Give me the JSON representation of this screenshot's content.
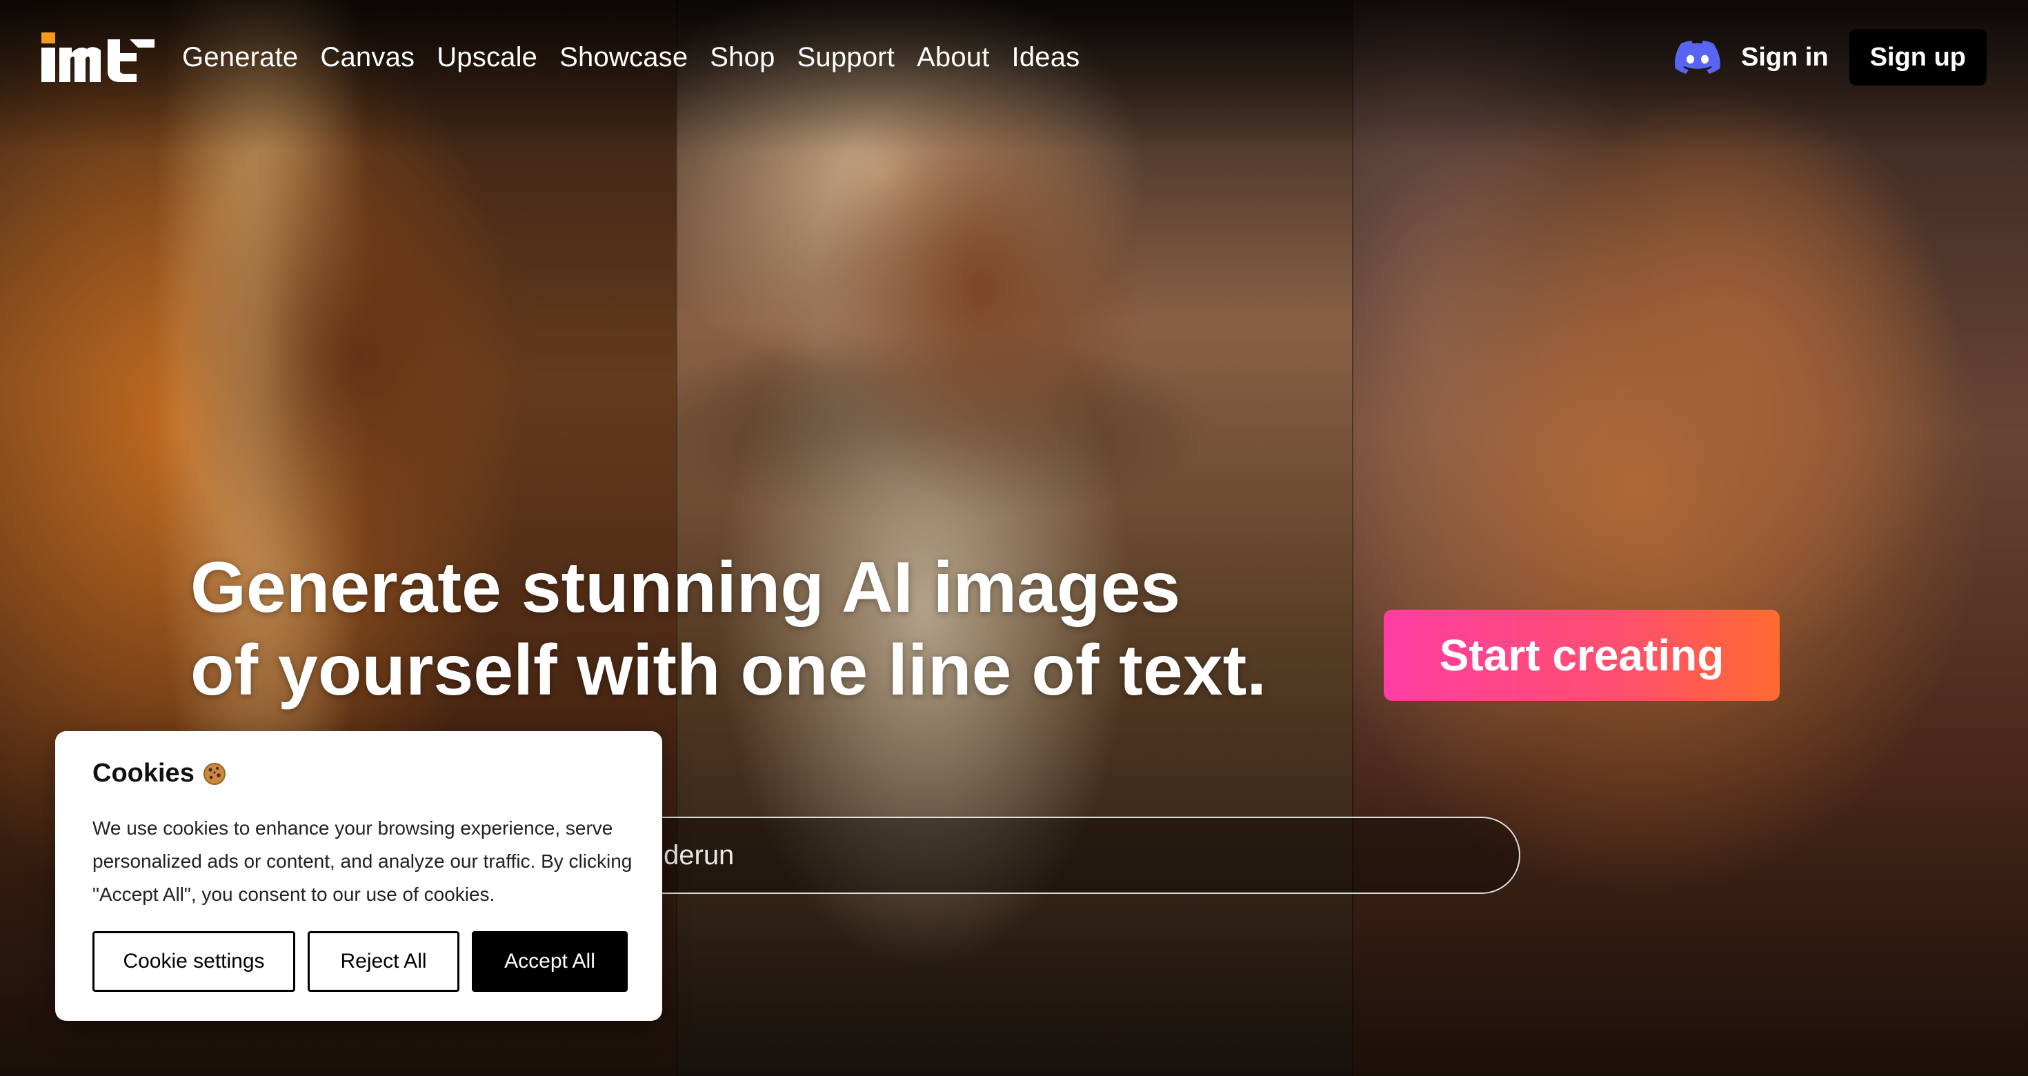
{
  "header": {
    "logo_icon": "mage-logo",
    "nav": [
      {
        "label": "Generate"
      },
      {
        "label": "Canvas"
      },
      {
        "label": "Upscale"
      },
      {
        "label": "Showcase"
      },
      {
        "label": "Shop"
      },
      {
        "label": "Support"
      },
      {
        "label": "About"
      },
      {
        "label": "Ideas"
      }
    ],
    "discord_icon": "discord-icon",
    "sign_in": "Sign in",
    "sign_up": "Sign up"
  },
  "hero": {
    "headline_line1": "Generate stunning AI images",
    "headline_line2": "of yourself with one line of text.",
    "cta": "Start creating",
    "prompt_text": "derun",
    "cta_gradient": [
      "#ff3da3",
      "#ff6a30"
    ]
  },
  "cookie_dialog": {
    "title": "Cookies",
    "title_icon": "cookie-icon",
    "body": "We use cookies to enhance your browsing experience, serve personalized ads or content, and analyze our traffic. By clicking \"Accept All\", you consent to our use of cookies.",
    "buttons": {
      "settings": "Cookie settings",
      "reject": "Reject All",
      "accept": "Accept All"
    }
  }
}
